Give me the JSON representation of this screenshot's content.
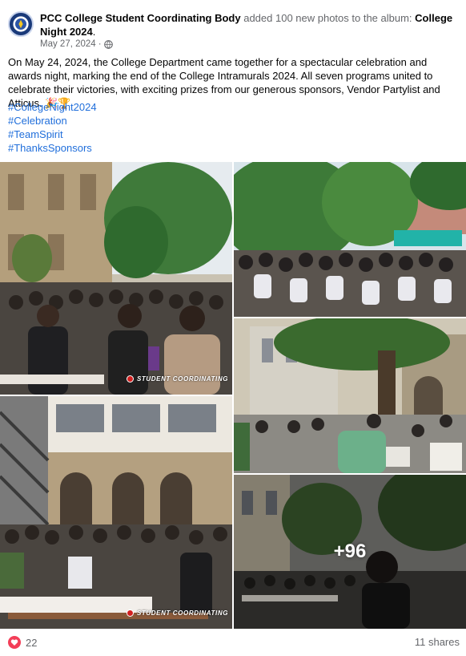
{
  "post": {
    "page_name": "PCC College Student Coordinating Body",
    "action": " added 100 new photos to the album: ",
    "album": "College Night 2024",
    "album_suffix": ".",
    "date": "May 27, 2024",
    "date_sep": " · ",
    "privacy_icon": "globe-icon",
    "caption": "On May 24, 2024, the College Department came together for a spectacular celebration and awards night, marking the end of the College Intramurals 2024. All seven programs united to celebrate their victories, with exciting prizes from our generous sponsors, Vendor Partylist and Atticus. 🎉🏆",
    "hashtags": [
      "#CollegeNight2024",
      "#Celebration",
      "#TeamSpirit",
      "#ThanksSponsors"
    ]
  },
  "photos": {
    "watermark": "STUDENT COORDINATING",
    "more_count": "+96"
  },
  "footer": {
    "reaction_count": "22",
    "reaction_icon": "heart-icon",
    "shares": "11 shares"
  },
  "colors": {
    "link": "#216fdb",
    "muted": "#65676b",
    "heart": "#f33e58"
  }
}
